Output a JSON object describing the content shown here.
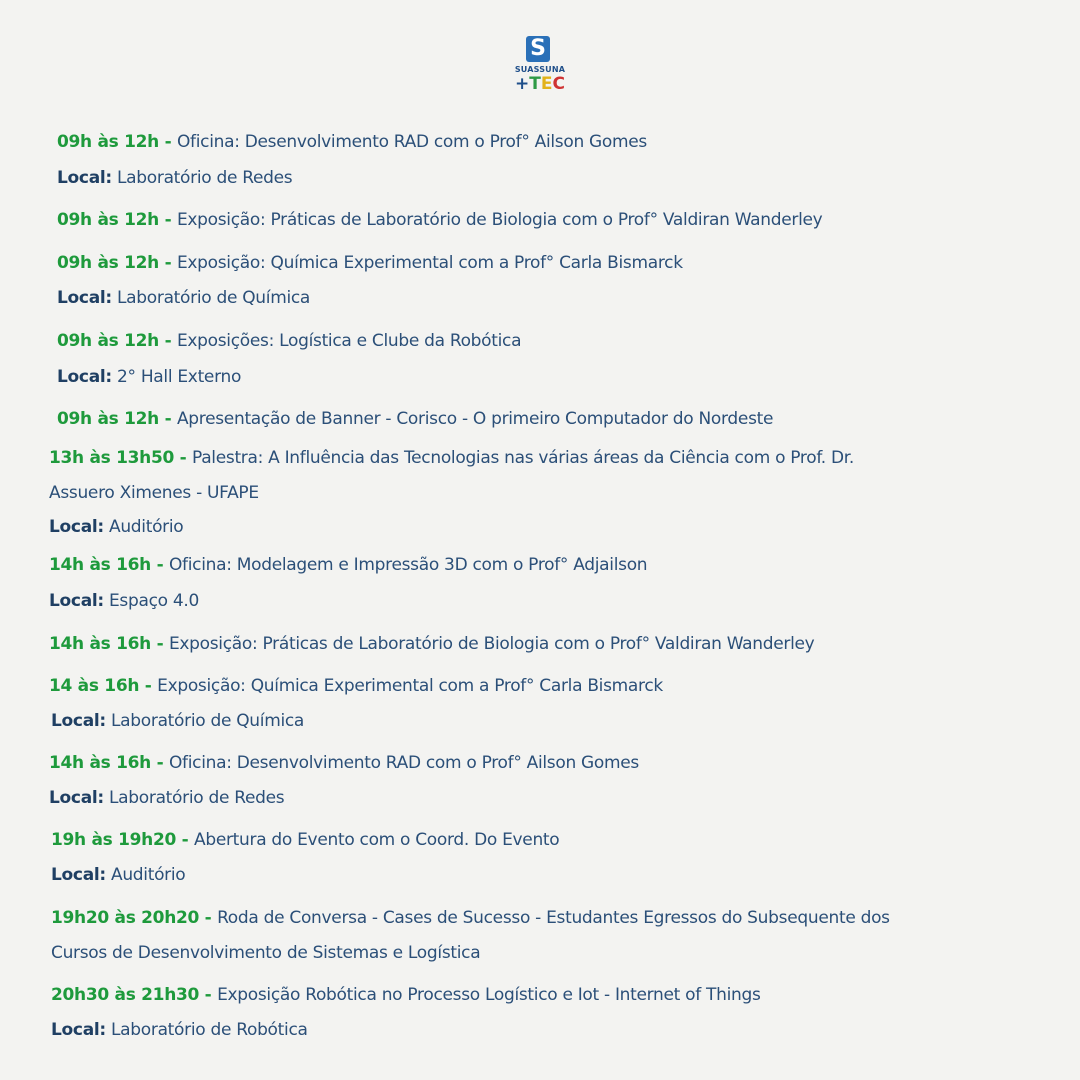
{
  "logo": {
    "s": "S",
    "name": "SUASSUNA",
    "plus": "+",
    "t": "T",
    "e": "E",
    "c": "C"
  },
  "entries": [
    {
      "time": "09h às 12h - ",
      "text": "Oficina: Desenvolvimento RAD com o Prof° Ailson Gomes"
    },
    {
      "label": "Local:",
      "text": " Laboratório de Redes"
    },
    {
      "time": "09h às 12h - ",
      "text": "Exposição: Práticas de Laboratório de Biologia com o  Prof° Valdiran Wanderley"
    },
    {
      "time": "09h às 12h - ",
      "text": "Exposição: Química Experimental  com a  Prof° Carla Bismarck"
    },
    {
      "label": "Local:",
      "text": " Laboratório de Química"
    },
    {
      "time": "09h às 12h - ",
      "text": "Exposições: Logística e Clube da Robótica"
    },
    {
      "label": "Local:",
      "text": "  2° Hall Externo"
    },
    {
      "time": "09h às 12h - ",
      "text": "Apresentação de Banner - Corisco - O primeiro Computador do Nordeste"
    },
    {
      "time": "13h às 13h50 - ",
      "text": "Palestra: A Influência das Tecnologias nas várias áreas da Ciência com o Prof. Dr."
    },
    {
      "text": "Assuero Ximenes - UFAPE"
    },
    {
      "label": "Local:",
      "text": " Auditório"
    },
    {
      "time": "14h às 16h - ",
      "text": "Oficina: Modelagem e Impressão 3D com o Prof° Adjailson"
    },
    {
      "label": "Local:",
      "text": " Espaço 4.0"
    },
    {
      "time": "14h às 16h - ",
      "text": "Exposição: Práticas de Laboratório de Biologia  com o Prof°  Valdiran Wanderley"
    },
    {
      "time": "14 às 16h - ",
      "text": "Exposição: Química Experimental  com a Prof° Carla Bismarck"
    },
    {
      "label": "Local:",
      "text": " Laboratório de Química"
    },
    {
      "time": "14h às 16h -  ",
      "text": "Oficina: Desenvolvimento RAD com o  Prof° Ailson Gomes"
    },
    {
      "label": "Local:",
      "text": " Laboratório de Redes"
    },
    {
      "time": "19h às 19h20  - ",
      "text": "Abertura do Evento com o Coord. Do Evento"
    },
    {
      "label": "Local:",
      "text": " Auditório"
    },
    {
      "time": "19h20 às  20h20  - ",
      "text": "Roda de Conversa - Cases de Sucesso - Estudantes Egressos do Subsequente dos"
    },
    {
      "text": "Cursos de Desenvolvimento de Sistemas e Logística"
    },
    {
      "time": "20h30 às  21h30 - ",
      "text": "Exposição Robótica no Processo Logístico e Iot - Internet of Things"
    },
    {
      "label": "Local:",
      "text": " Laboratório de Robótica"
    }
  ],
  "colors": {
    "time": "#1e9a3c",
    "text": "#2b4f78",
    "label": "#1f3f63",
    "background": "#f3f3f1"
  }
}
